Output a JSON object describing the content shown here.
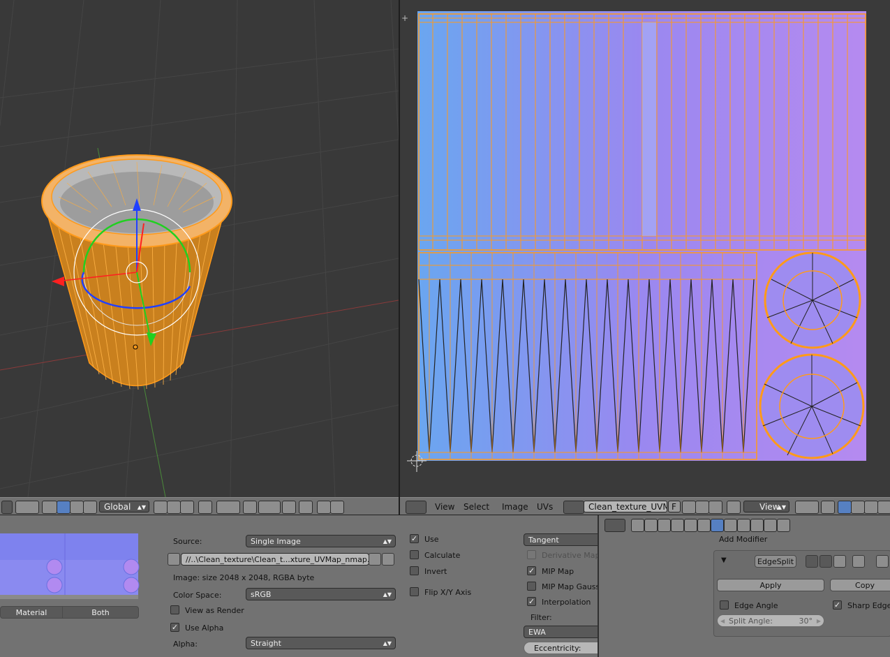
{
  "colors": {
    "accent": "#5680c2",
    "selection": "#ff9a1a",
    "normal_map": "#8f86f2",
    "x_axis": "#ff2020",
    "y_axis": "#20d020",
    "z_axis": "#2040ff"
  },
  "icons": [
    "editor-type-icon",
    "view-shading-icon",
    "pivot-icon",
    "manipulator-icon",
    "snap-icon",
    "render-icon",
    "pin-icon",
    "modifier-icon",
    "expand-icon",
    "mesh-icon"
  ],
  "viewport3d_header": {
    "orientation": "Global"
  },
  "uv_header": {
    "menus": [
      "View",
      "Select",
      "Image",
      "UVs"
    ],
    "image_name": "Clean_texture_UVM...",
    "fake_user": "F",
    "display_mode": "View"
  },
  "texture_panel": {
    "preview_buttons": [
      "Material",
      "Both"
    ],
    "source_label": "Source:",
    "source_value": "Single Image",
    "filepath": "//..\\Clean_texture\\Clean_t...xture_UVMap_nmap.png",
    "image_info": "Image: size 2048 x 2048, RGBA byte",
    "color_space_label": "Color Space:",
    "color_space_value": "sRGB",
    "view_as_render": "View as Render",
    "use_alpha": "Use Alpha",
    "alpha_label": "Alpha:",
    "alpha_value": "Straight"
  },
  "image_sampling": {
    "use": "Use",
    "calculate": "Calculate",
    "invert": "Invert",
    "flip_xy": "Flip X/Y Axis",
    "normal_space": "Tangent",
    "derivative_map": "Derivative Map",
    "mip_map": "MIP Map",
    "mip_map_gaussian": "MIP Map Gaussi",
    "interpolation": "Interpolation",
    "filter_label": "Filter:",
    "filter_value": "EWA",
    "eccentricity": "Eccentricity:"
  },
  "modifier_panel": {
    "add_modifier": "Add Modifier",
    "modifier_name": "EdgeSplit",
    "apply": "Apply",
    "copy": "Copy",
    "edge_angle": "Edge Angle",
    "sharp_edges": "Sharp Edges",
    "split_angle_label": "Split Angle:",
    "split_angle_value": "30°"
  }
}
